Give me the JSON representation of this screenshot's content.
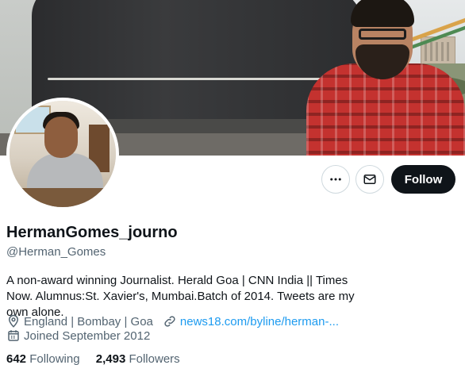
{
  "profile": {
    "display_name": "HermanGomes_journo",
    "handle": "@Herman_Gomes",
    "bio": "A non-award winning Journalist. Herald Goa | CNN India || Times Now. Alumnus:St. Xavier's, Mumbai.Batch of 2014. Tweets are my own alone.",
    "location": "England | Bombay | Goa",
    "website": "news18.com/byline/herman-...",
    "joined": "Joined September 2012",
    "following_count": "642",
    "following_label": "Following",
    "followers_count": "2,493",
    "followers_label": "Followers"
  },
  "actions": {
    "more_label": "•••",
    "follow_label": "Follow"
  },
  "colors": {
    "text_primary": "#0f1419",
    "text_secondary": "#536471",
    "link": "#1d9bf0",
    "follow_bg": "#0f1419"
  },
  "icons": {
    "more": "more-horizontal-icon",
    "message": "envelope-icon",
    "location": "location-pin-icon",
    "link": "link-icon",
    "calendar": "calendar-icon"
  }
}
